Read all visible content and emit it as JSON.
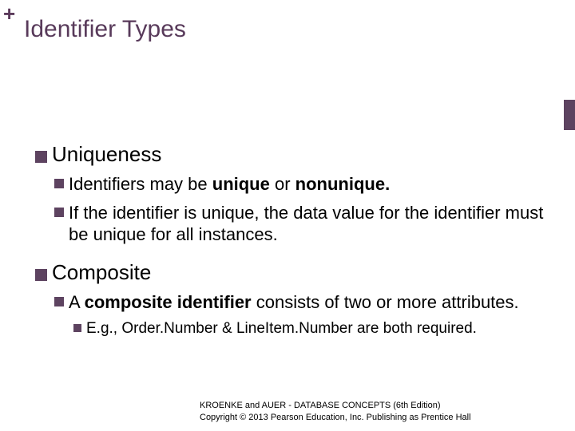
{
  "corner_symbol": "+",
  "title": "Identifier Types",
  "sections": [
    {
      "heading": "Uniqueness",
      "subs": [
        {
          "pre": "Identifiers may be ",
          "b1": "unique",
          "mid": " or ",
          "b2": "nonunique.",
          "post": ""
        },
        {
          "plain": "If the identifier is unique, the data value for the identifier must be unique for all instances."
        }
      ]
    },
    {
      "heading": "Composite",
      "subs": [
        {
          "pre": "A ",
          "b1": "composite identifier",
          "mid": "",
          "b2": "",
          "post": " consists of two or more attributes."
        }
      ],
      "subsubs": [
        {
          "plain": "E.g., Order.Number & LineItem.Number are both required."
        }
      ]
    }
  ],
  "footer": {
    "line1": "KROENKE and AUER - DATABASE CONCEPTS (6th Edition)",
    "line2": "Copyright © 2013 Pearson Education, Inc. Publishing as Prentice Hall"
  }
}
